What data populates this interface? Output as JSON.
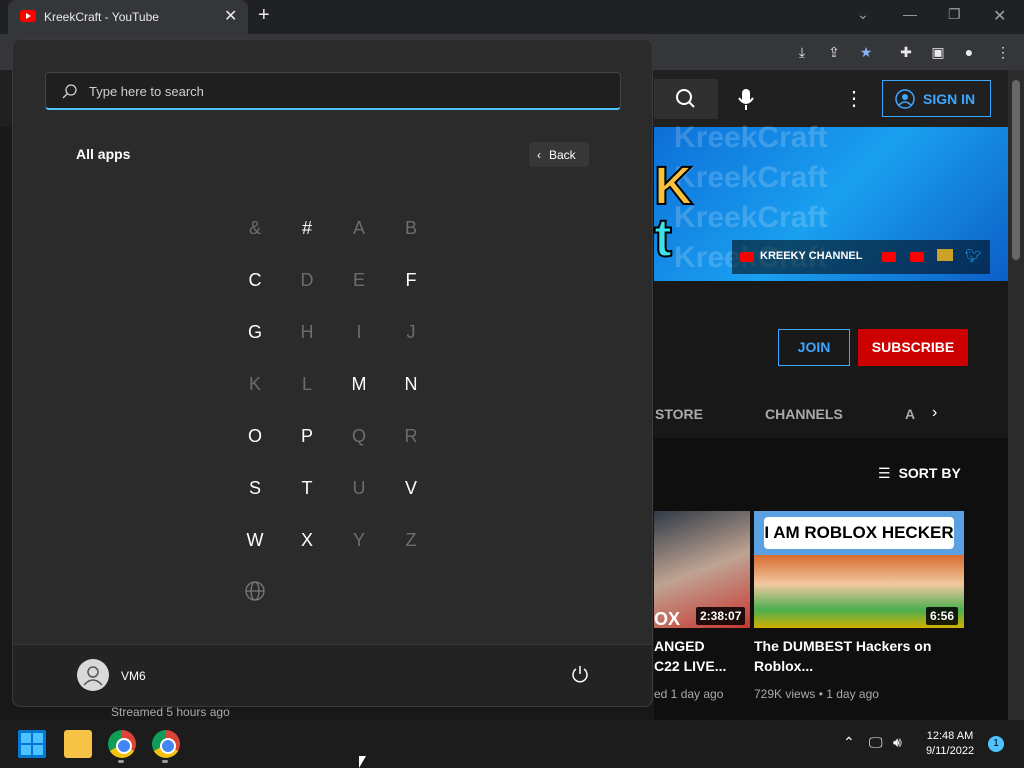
{
  "browser": {
    "tab_title": "KreekCraft - YouTube",
    "tab_close": "✕",
    "new_tab": "+"
  },
  "youtube": {
    "sign_in": "SIGN IN",
    "banner_watermark": "KreekCraft",
    "banner_logo_line1": "K",
    "banner_logo_line2": "t",
    "banner_channel": "KREEKY CHANNEL",
    "join": "JOIN",
    "subscribe": "SUBSCRIBE",
    "tabs": [
      "STORE",
      "CHANNELS",
      "A"
    ],
    "sort_by": "SORT BY",
    "videos": [
      {
        "title_line1": "ANGED",
        "title_line2": "C22 LIVE...",
        "meta": "ed 1 day ago",
        "duration": "2:38:07",
        "thumb_text": "OX"
      },
      {
        "title_line1": "The DUMBEST Hackers on",
        "title_line2": "Roblox...",
        "meta": "729K views • 1 day ago",
        "duration": "6:56",
        "thumb_text": "I AM ROBLOX HECKER"
      }
    ],
    "behind_menu_meta": "Streamed 5 hours ago"
  },
  "start_menu": {
    "search_placeholder": "Type here to search",
    "all_apps": "All apps",
    "back": "Back",
    "letters": [
      {
        "char": "&",
        "enabled": false
      },
      {
        "char": "#",
        "enabled": true
      },
      {
        "char": "A",
        "enabled": false
      },
      {
        "char": "B",
        "enabled": false
      },
      {
        "char": "C",
        "enabled": true
      },
      {
        "char": "D",
        "enabled": false
      },
      {
        "char": "E",
        "enabled": false
      },
      {
        "char": "F",
        "enabled": true
      },
      {
        "char": "G",
        "enabled": true
      },
      {
        "char": "H",
        "enabled": false
      },
      {
        "char": "I",
        "enabled": false
      },
      {
        "char": "J",
        "enabled": false
      },
      {
        "char": "K",
        "enabled": false
      },
      {
        "char": "L",
        "enabled": false
      },
      {
        "char": "M",
        "enabled": true
      },
      {
        "char": "N",
        "enabled": true
      },
      {
        "char": "O",
        "enabled": true
      },
      {
        "char": "P",
        "enabled": true
      },
      {
        "char": "Q",
        "enabled": false
      },
      {
        "char": "R",
        "enabled": false
      },
      {
        "char": "S",
        "enabled": true
      },
      {
        "char": "T",
        "enabled": true
      },
      {
        "char": "U",
        "enabled": false
      },
      {
        "char": "V",
        "enabled": true
      },
      {
        "char": "W",
        "enabled": true
      },
      {
        "char": "X",
        "enabled": true
      },
      {
        "char": "Y",
        "enabled": false
      },
      {
        "char": "Z",
        "enabled": false
      }
    ],
    "user_name": "VM6"
  },
  "taskbar": {
    "time": "12:48 AM",
    "date": "9/11/2022",
    "notification_count": "1"
  },
  "icons": [
    "youtube-icon",
    "search-icon",
    "mic-icon",
    "more-icon",
    "person-icon",
    "sort-icon",
    "windows-start-icon",
    "file-explorer-icon",
    "chrome-icon",
    "globe-icon",
    "power-icon"
  ],
  "colors": {
    "accent": "#4cc2ff",
    "youtube_red": "#cc0000",
    "youtube_blue": "#3ea6ff"
  }
}
